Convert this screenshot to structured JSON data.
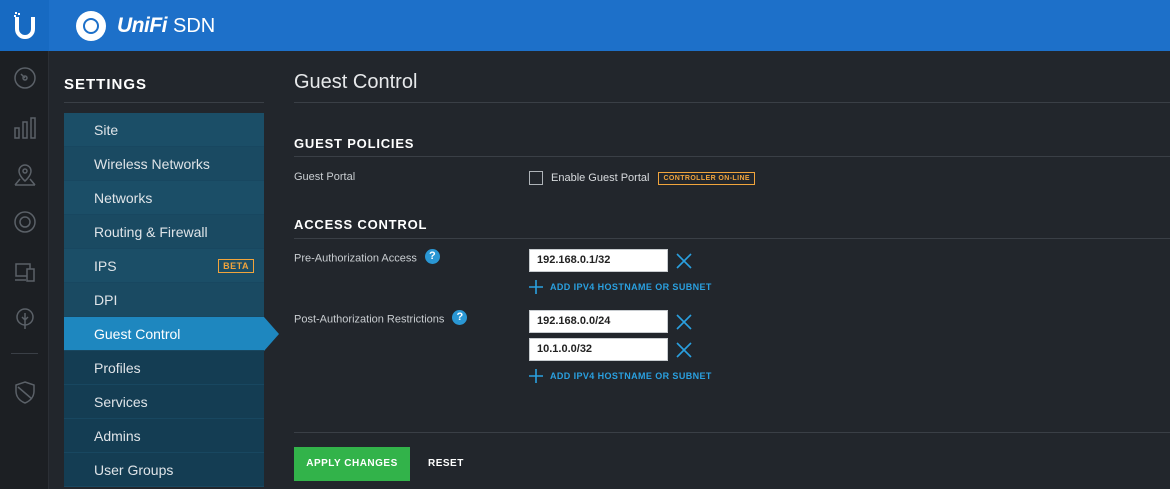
{
  "header": {
    "brand_name": "UniFi",
    "brand_suffix": "SDN",
    "logo_icon": "ubiquiti-u-icon",
    "accent_color": "#1d70c9"
  },
  "rail": {
    "icons": [
      "dashboard-icon",
      "statistics-icon",
      "map-icon",
      "devices-icon",
      "clients-icon",
      "insights-icon",
      "alerts-icon"
    ]
  },
  "settings": {
    "title": "SETTINGS",
    "nav": [
      {
        "label": "Site"
      },
      {
        "label": "Wireless Networks"
      },
      {
        "label": "Networks"
      },
      {
        "label": "Routing & Firewall"
      },
      {
        "label": "IPS",
        "badge": "BETA"
      },
      {
        "label": "DPI"
      },
      {
        "label": "Guest Control",
        "active": true
      },
      {
        "label": "Profiles"
      },
      {
        "label": "Services"
      },
      {
        "label": "Admins"
      },
      {
        "label": "User Groups"
      }
    ]
  },
  "main": {
    "title": "Guest Control",
    "guest_policies": {
      "heading": "GUEST POLICIES",
      "guest_portal_label": "Guest Portal",
      "enable_label": "Enable Guest Portal",
      "enable_checked": false,
      "controller_badge": "CONTROLLER ON-LINE"
    },
    "access_control": {
      "heading": "ACCESS CONTROL",
      "pre_auth_label": "Pre-Authorization Access",
      "pre_auth_entries": [
        "192.168.0.1/32"
      ],
      "post_auth_label": "Post-Authorization Restrictions",
      "post_auth_entries": [
        "192.168.0.0/24",
        "10.1.0.0/32"
      ],
      "add_label": "ADD IPV4 HOSTNAME OR SUBNET",
      "help_glyph": "?"
    },
    "actions": {
      "apply_label": "APPLY CHANGES",
      "reset_label": "RESET",
      "apply_color": "#32b34a"
    }
  }
}
